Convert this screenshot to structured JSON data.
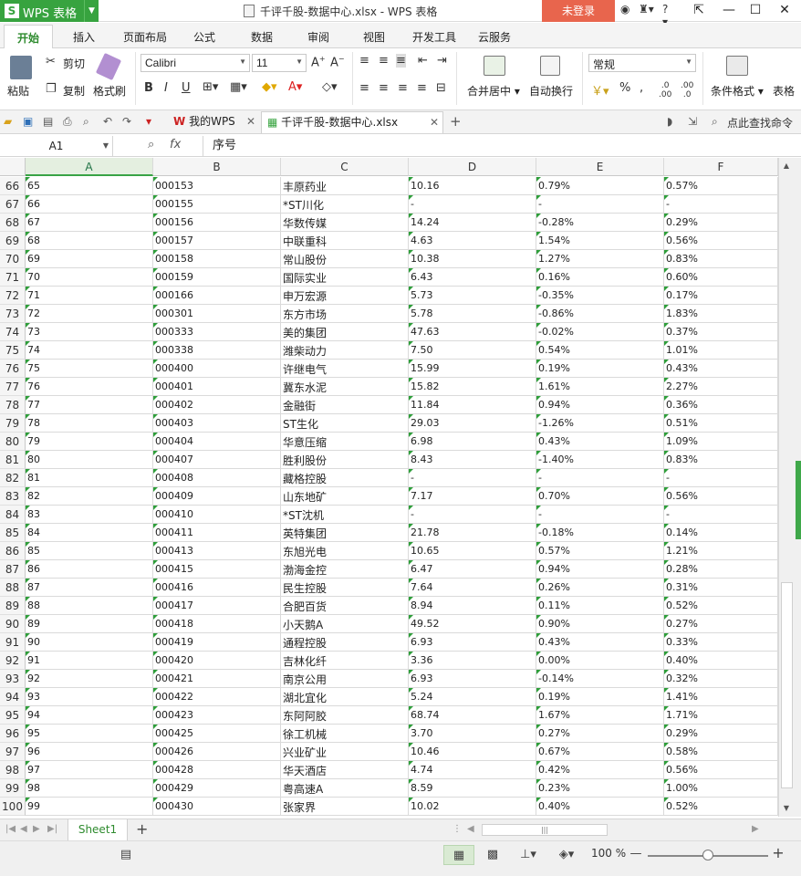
{
  "app": {
    "menu_button": "WPS 表格",
    "doc_title": "千评千股-数据中心.xlsx - WPS 表格",
    "login_label": "未登录"
  },
  "ribbon_tabs": [
    "开始",
    "插入",
    "页面布局",
    "公式",
    "数据",
    "审阅",
    "视图",
    "开发工具",
    "云服务"
  ],
  "ribbon": {
    "paste": "粘贴",
    "cut": "剪切",
    "copy": "复制",
    "format_painter": "格式刷",
    "font_name": "Calibri",
    "font_size": "11",
    "merge_center": "合并居中",
    "wrap_text": "自动换行",
    "number_format": "常规",
    "conditional_format": "条件格式",
    "table_style": "表格"
  },
  "doc_tabs": {
    "my_wps": "我的WPS",
    "file": "千评千股-数据中心.xlsx",
    "search_cmd": "点此查找命令"
  },
  "formula_bar": {
    "cell_ref": "A1",
    "fx": "fx",
    "content": "序号"
  },
  "columns": [
    "A",
    "B",
    "C",
    "D",
    "E",
    "F"
  ],
  "rows": [
    {
      "r": "66",
      "a": "65",
      "b": "000153",
      "c": "丰原药业",
      "d": "10.16",
      "e": "0.79%",
      "f": "0.57%"
    },
    {
      "r": "67",
      "a": "66",
      "b": "000155",
      "c": "*ST川化",
      "d": "-",
      "e": "-",
      "f": "-"
    },
    {
      "r": "68",
      "a": "67",
      "b": "000156",
      "c": "华数传媒",
      "d": "14.24",
      "e": "-0.28%",
      "f": "0.29%"
    },
    {
      "r": "69",
      "a": "68",
      "b": "000157",
      "c": "中联重科",
      "d": "4.63",
      "e": "1.54%",
      "f": "0.56%"
    },
    {
      "r": "70",
      "a": "69",
      "b": "000158",
      "c": "常山股份",
      "d": "10.38",
      "e": "1.27%",
      "f": "0.83%"
    },
    {
      "r": "71",
      "a": "70",
      "b": "000159",
      "c": "国际实业",
      "d": "6.43",
      "e": "0.16%",
      "f": "0.60%"
    },
    {
      "r": "72",
      "a": "71",
      "b": "000166",
      "c": "申万宏源",
      "d": "5.73",
      "e": "-0.35%",
      "f": "0.17%"
    },
    {
      "r": "73",
      "a": "72",
      "b": "000301",
      "c": "东方市场",
      "d": "5.78",
      "e": "-0.86%",
      "f": "1.83%"
    },
    {
      "r": "74",
      "a": "73",
      "b": "000333",
      "c": "美的集团",
      "d": "47.63",
      "e": "-0.02%",
      "f": "0.37%"
    },
    {
      "r": "75",
      "a": "74",
      "b": "000338",
      "c": "潍柴动力",
      "d": "7.50",
      "e": "0.54%",
      "f": "1.01%"
    },
    {
      "r": "76",
      "a": "75",
      "b": "000400",
      "c": "许继电气",
      "d": "15.99",
      "e": "0.19%",
      "f": "0.43%"
    },
    {
      "r": "77",
      "a": "76",
      "b": "000401",
      "c": "冀东水泥",
      "d": "15.82",
      "e": "1.61%",
      "f": "2.27%"
    },
    {
      "r": "78",
      "a": "77",
      "b": "000402",
      "c": "金融街",
      "d": "11.84",
      "e": "0.94%",
      "f": "0.36%"
    },
    {
      "r": "79",
      "a": "78",
      "b": "000403",
      "c": "ST生化",
      "d": "29.03",
      "e": "-1.26%",
      "f": "0.51%"
    },
    {
      "r": "80",
      "a": "79",
      "b": "000404",
      "c": "华意压缩",
      "d": "6.98",
      "e": "0.43%",
      "f": "1.09%"
    },
    {
      "r": "81",
      "a": "80",
      "b": "000407",
      "c": "胜利股份",
      "d": "8.43",
      "e": "-1.40%",
      "f": "0.83%"
    },
    {
      "r": "82",
      "a": "81",
      "b": "000408",
      "c": "藏格控股",
      "d": "-",
      "e": "-",
      "f": "-"
    },
    {
      "r": "83",
      "a": "82",
      "b": "000409",
      "c": "山东地矿",
      "d": "7.17",
      "e": "0.70%",
      "f": "0.56%"
    },
    {
      "r": "84",
      "a": "83",
      "b": "000410",
      "c": "*ST沈机",
      "d": "-",
      "e": "-",
      "f": "-"
    },
    {
      "r": "85",
      "a": "84",
      "b": "000411",
      "c": "英特集团",
      "d": "21.78",
      "e": "-0.18%",
      "f": "0.14%"
    },
    {
      "r": "86",
      "a": "85",
      "b": "000413",
      "c": "东旭光电",
      "d": "10.65",
      "e": "0.57%",
      "f": "1.21%"
    },
    {
      "r": "87",
      "a": "86",
      "b": "000415",
      "c": "渤海金控",
      "d": "6.47",
      "e": "0.94%",
      "f": "0.28%"
    },
    {
      "r": "88",
      "a": "87",
      "b": "000416",
      "c": "民生控股",
      "d": "7.64",
      "e": "0.26%",
      "f": "0.31%"
    },
    {
      "r": "89",
      "a": "88",
      "b": "000417",
      "c": "合肥百货",
      "d": "8.94",
      "e": "0.11%",
      "f": "0.52%"
    },
    {
      "r": "90",
      "a": "89",
      "b": "000418",
      "c": "小天鹅A",
      "d": "49.52",
      "e": "0.90%",
      "f": "0.27%"
    },
    {
      "r": "91",
      "a": "90",
      "b": "000419",
      "c": "通程控股",
      "d": "6.93",
      "e": "0.43%",
      "f": "0.33%"
    },
    {
      "r": "92",
      "a": "91",
      "b": "000420",
      "c": "吉林化纤",
      "d": "3.36",
      "e": "0.00%",
      "f": "0.40%"
    },
    {
      "r": "93",
      "a": "92",
      "b": "000421",
      "c": "南京公用",
      "d": "6.93",
      "e": "-0.14%",
      "f": "0.32%"
    },
    {
      "r": "94",
      "a": "93",
      "b": "000422",
      "c": "湖北宜化",
      "d": "5.24",
      "e": "0.19%",
      "f": "1.41%"
    },
    {
      "r": "95",
      "a": "94",
      "b": "000423",
      "c": "东阿阿胶",
      "d": "68.74",
      "e": "1.67%",
      "f": "1.71%"
    },
    {
      "r": "96",
      "a": "95",
      "b": "000425",
      "c": "徐工机械",
      "d": "3.70",
      "e": "0.27%",
      "f": "0.29%"
    },
    {
      "r": "97",
      "a": "96",
      "b": "000426",
      "c": "兴业矿业",
      "d": "10.46",
      "e": "0.67%",
      "f": "0.58%"
    },
    {
      "r": "98",
      "a": "97",
      "b": "000428",
      "c": "华天酒店",
      "d": "4.74",
      "e": "0.42%",
      "f": "0.56%"
    },
    {
      "r": "99",
      "a": "98",
      "b": "000429",
      "c": "粤高速A",
      "d": "8.59",
      "e": "0.23%",
      "f": "1.00%"
    },
    {
      "r": "100",
      "a": "99",
      "b": "000430",
      "c": "张家界",
      "d": "10.02",
      "e": "0.40%",
      "f": "0.52%"
    }
  ],
  "sheet_tabs": [
    "Sheet1"
  ],
  "status": {
    "zoom": "100 %",
    "zoom_fraction": 0.5
  },
  "colors": {
    "brand_green": "#37a33f",
    "login_bg": "#e8654d"
  }
}
